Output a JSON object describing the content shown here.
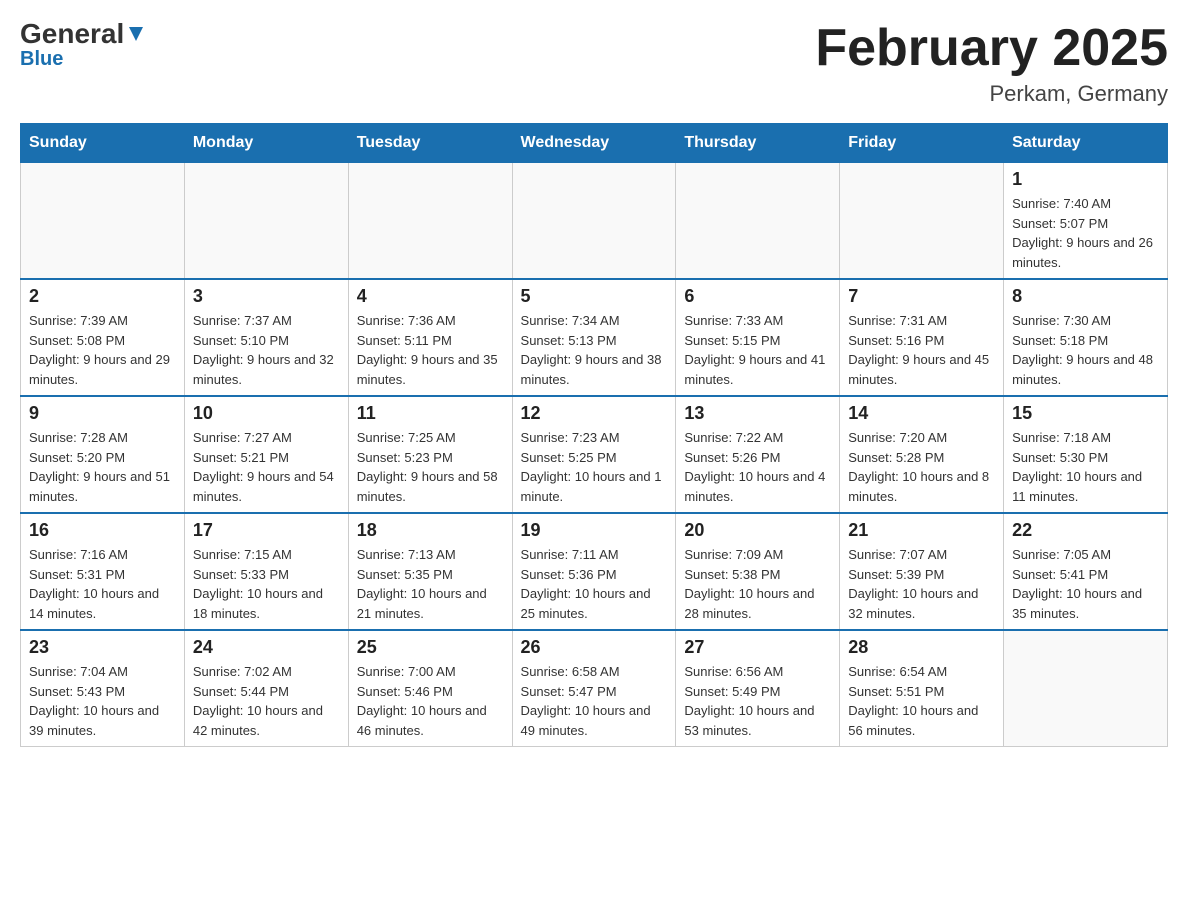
{
  "logo": {
    "general": "General",
    "arrow": "▾",
    "blue": "Blue"
  },
  "title": {
    "month_year": "February 2025",
    "location": "Perkam, Germany"
  },
  "weekdays": [
    "Sunday",
    "Monday",
    "Tuesday",
    "Wednesday",
    "Thursday",
    "Friday",
    "Saturday"
  ],
  "weeks": [
    [
      {
        "day": "",
        "info": ""
      },
      {
        "day": "",
        "info": ""
      },
      {
        "day": "",
        "info": ""
      },
      {
        "day": "",
        "info": ""
      },
      {
        "day": "",
        "info": ""
      },
      {
        "day": "",
        "info": ""
      },
      {
        "day": "1",
        "info": "Sunrise: 7:40 AM\nSunset: 5:07 PM\nDaylight: 9 hours and 26 minutes."
      }
    ],
    [
      {
        "day": "2",
        "info": "Sunrise: 7:39 AM\nSunset: 5:08 PM\nDaylight: 9 hours and 29 minutes."
      },
      {
        "day": "3",
        "info": "Sunrise: 7:37 AM\nSunset: 5:10 PM\nDaylight: 9 hours and 32 minutes."
      },
      {
        "day": "4",
        "info": "Sunrise: 7:36 AM\nSunset: 5:11 PM\nDaylight: 9 hours and 35 minutes."
      },
      {
        "day": "5",
        "info": "Sunrise: 7:34 AM\nSunset: 5:13 PM\nDaylight: 9 hours and 38 minutes."
      },
      {
        "day": "6",
        "info": "Sunrise: 7:33 AM\nSunset: 5:15 PM\nDaylight: 9 hours and 41 minutes."
      },
      {
        "day": "7",
        "info": "Sunrise: 7:31 AM\nSunset: 5:16 PM\nDaylight: 9 hours and 45 minutes."
      },
      {
        "day": "8",
        "info": "Sunrise: 7:30 AM\nSunset: 5:18 PM\nDaylight: 9 hours and 48 minutes."
      }
    ],
    [
      {
        "day": "9",
        "info": "Sunrise: 7:28 AM\nSunset: 5:20 PM\nDaylight: 9 hours and 51 minutes."
      },
      {
        "day": "10",
        "info": "Sunrise: 7:27 AM\nSunset: 5:21 PM\nDaylight: 9 hours and 54 minutes."
      },
      {
        "day": "11",
        "info": "Sunrise: 7:25 AM\nSunset: 5:23 PM\nDaylight: 9 hours and 58 minutes."
      },
      {
        "day": "12",
        "info": "Sunrise: 7:23 AM\nSunset: 5:25 PM\nDaylight: 10 hours and 1 minute."
      },
      {
        "day": "13",
        "info": "Sunrise: 7:22 AM\nSunset: 5:26 PM\nDaylight: 10 hours and 4 minutes."
      },
      {
        "day": "14",
        "info": "Sunrise: 7:20 AM\nSunset: 5:28 PM\nDaylight: 10 hours and 8 minutes."
      },
      {
        "day": "15",
        "info": "Sunrise: 7:18 AM\nSunset: 5:30 PM\nDaylight: 10 hours and 11 minutes."
      }
    ],
    [
      {
        "day": "16",
        "info": "Sunrise: 7:16 AM\nSunset: 5:31 PM\nDaylight: 10 hours and 14 minutes."
      },
      {
        "day": "17",
        "info": "Sunrise: 7:15 AM\nSunset: 5:33 PM\nDaylight: 10 hours and 18 minutes."
      },
      {
        "day": "18",
        "info": "Sunrise: 7:13 AM\nSunset: 5:35 PM\nDaylight: 10 hours and 21 minutes."
      },
      {
        "day": "19",
        "info": "Sunrise: 7:11 AM\nSunset: 5:36 PM\nDaylight: 10 hours and 25 minutes."
      },
      {
        "day": "20",
        "info": "Sunrise: 7:09 AM\nSunset: 5:38 PM\nDaylight: 10 hours and 28 minutes."
      },
      {
        "day": "21",
        "info": "Sunrise: 7:07 AM\nSunset: 5:39 PM\nDaylight: 10 hours and 32 minutes."
      },
      {
        "day": "22",
        "info": "Sunrise: 7:05 AM\nSunset: 5:41 PM\nDaylight: 10 hours and 35 minutes."
      }
    ],
    [
      {
        "day": "23",
        "info": "Sunrise: 7:04 AM\nSunset: 5:43 PM\nDaylight: 10 hours and 39 minutes."
      },
      {
        "day": "24",
        "info": "Sunrise: 7:02 AM\nSunset: 5:44 PM\nDaylight: 10 hours and 42 minutes."
      },
      {
        "day": "25",
        "info": "Sunrise: 7:00 AM\nSunset: 5:46 PM\nDaylight: 10 hours and 46 minutes."
      },
      {
        "day": "26",
        "info": "Sunrise: 6:58 AM\nSunset: 5:47 PM\nDaylight: 10 hours and 49 minutes."
      },
      {
        "day": "27",
        "info": "Sunrise: 6:56 AM\nSunset: 5:49 PM\nDaylight: 10 hours and 53 minutes."
      },
      {
        "day": "28",
        "info": "Sunrise: 6:54 AM\nSunset: 5:51 PM\nDaylight: 10 hours and 56 minutes."
      },
      {
        "day": "",
        "info": ""
      }
    ]
  ]
}
